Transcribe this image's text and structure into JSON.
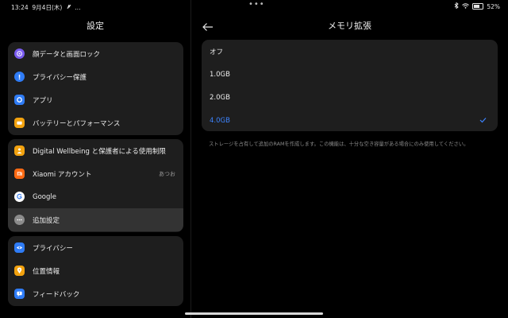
{
  "status": {
    "time": "13:24",
    "date": "9月4日(木)",
    "extra": "…",
    "center": "•••",
    "battery": "52"
  },
  "left": {
    "title": "設定",
    "groups": [
      [
        {
          "label": "顔データと画面ロック",
          "icon": "face-lock-icon",
          "color": "#7a5cf0"
        },
        {
          "label": "プライバシー保護",
          "icon": "privacy-protection-icon",
          "color": "#2f7cf6"
        },
        {
          "label": "アプリ",
          "icon": "apps-icon",
          "color": "#2f7cf6"
        },
        {
          "label": "バッテリーとパフォーマンス",
          "icon": "battery-icon",
          "color": "#f2a20f"
        }
      ],
      [
        {
          "label": "Digital Wellbeing と保護者による使用制限",
          "icon": "digital-wellbeing-icon",
          "color": "#f2a20f"
        },
        {
          "label": "Xiaomi アカウント",
          "icon": "xiaomi-account-icon",
          "color": "#ff6a13",
          "value": "あつお"
        },
        {
          "label": "Google",
          "icon": "google-icon",
          "color": "#ffffff"
        },
        {
          "label": "追加設定",
          "icon": "additional-settings-icon",
          "color": "#8c8c8c"
        }
      ],
      [
        {
          "label": "プライバシー",
          "icon": "privacy-eye-icon",
          "color": "#2f7cf6"
        },
        {
          "label": "位置情報",
          "icon": "location-icon",
          "color": "#f2a20f"
        },
        {
          "label": "フィードバック",
          "icon": "feedback-icon",
          "color": "#2f7cf6"
        }
      ]
    ]
  },
  "right": {
    "title": "メモリ拡張",
    "options": [
      "オフ",
      "1.0GB",
      "2.0GB",
      "4.0GB"
    ],
    "selected": "4.0GB",
    "note": "ストレージを占有して追加のRAMを作成します。この機能は、十分な空き容量がある場合にのみ使用してください。"
  }
}
